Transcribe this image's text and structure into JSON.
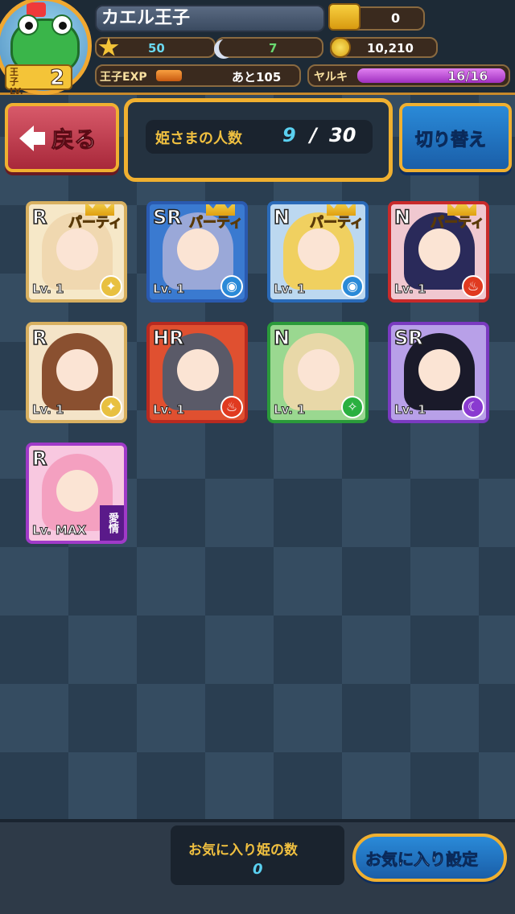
{
  "player": {
    "name": "カエル王子",
    "level_label": "王子LV.",
    "level": "2",
    "crowns": "0",
    "stars": "50",
    "moons": "7",
    "coins": "10,210",
    "exp_label": "王子EXP",
    "exp_remaining": "あと105",
    "yaruki_label": "ヤルキ",
    "yaruki_value": "16/16",
    "yaruki_fraction": 1.0
  },
  "nav": {
    "back_label": "戻る",
    "switch_label": "切り替え"
  },
  "princess_count": {
    "label": "姫さまの人数",
    "current": "9",
    "separator": "/",
    "max": "30"
  },
  "cards": [
    {
      "rarity": "R",
      "party": "パーティ",
      "level": "Lv. 1",
      "element": "light-icon",
      "hair": "#f0d8b0",
      "bg": "#f6e8c8",
      "border": "#d8b060"
    },
    {
      "rarity": "SR",
      "party": "パーティ",
      "level": "Lv. 1",
      "element": "water-icon",
      "hair": "#9aa8d8",
      "bg": "#3a7ad0",
      "border": "#2a5ab0"
    },
    {
      "rarity": "N",
      "party": "パーティ",
      "level": "Lv. 1",
      "element": "water-icon",
      "hair": "#f0d060",
      "bg": "#bcd8f0",
      "border": "#2a6ab8"
    },
    {
      "rarity": "N",
      "party": "パーティ",
      "level": "Lv. 1",
      "element": "fire-icon",
      "hair": "#2a2a5a",
      "bg": "#f0c8d0",
      "border": "#c82a2a"
    },
    {
      "rarity": "R",
      "party": "",
      "level": "Lv. 1",
      "element": "light-icon",
      "hair": "#8a5030",
      "bg": "#f4e4c8",
      "border": "#d8b060"
    },
    {
      "rarity": "HR",
      "party": "",
      "level": "Lv. 1",
      "element": "fire-icon",
      "hair": "#5a5a68",
      "bg": "#e05030",
      "border": "#b82a20"
    },
    {
      "rarity": "N",
      "party": "",
      "level": "Lv. 1",
      "element": "wind-icon",
      "hair": "#e8d8a8",
      "bg": "#9ad890",
      "border": "#2a9a3a"
    },
    {
      "rarity": "SR",
      "party": "",
      "level": "Lv. 1",
      "element": "moon-icon",
      "hair": "#1a1a2a",
      "bg": "#b8a0e8",
      "border": "#7a3ac0"
    },
    {
      "rarity": "R",
      "party": "",
      "level": "Lv. MAX",
      "element": "affection",
      "affection": "愛情",
      "hair": "#f4a0c0",
      "bg": "#f8c8e0",
      "border": "#a03ac8"
    }
  ],
  "favorites": {
    "label": "お気に入り姫の数",
    "count": "0",
    "button_label": "お気に入り設定"
  },
  "colors": {
    "gold": "#f0b030",
    "back_button": "#c8404e",
    "blue_button": "#2a7ad0",
    "count_current": "#5ad0f0",
    "count_label": "#f0c040"
  }
}
